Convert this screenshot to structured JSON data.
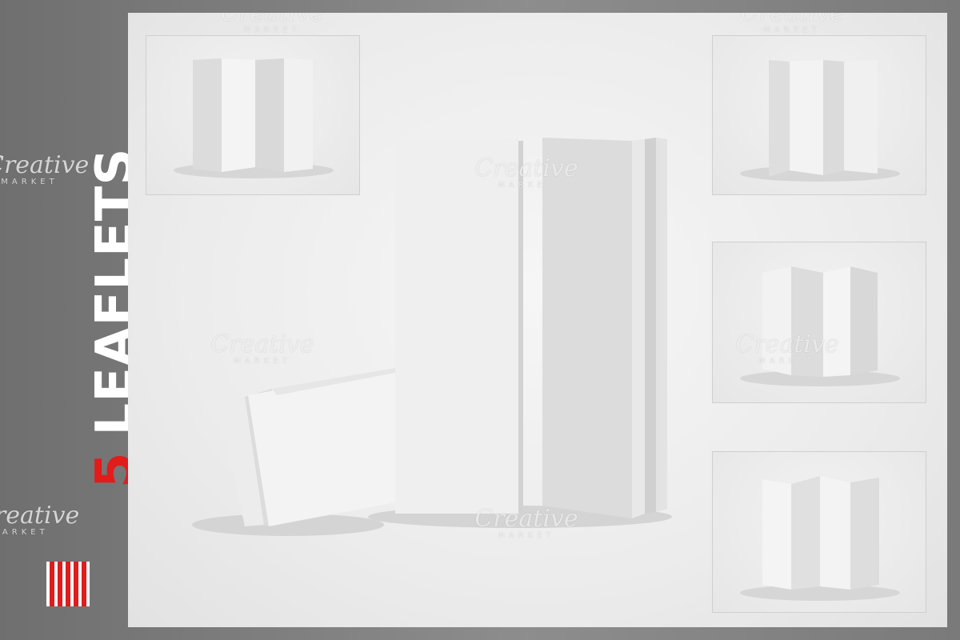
{
  "side": {
    "count": "5",
    "word": "LEAFLETS",
    "accent": "#e21b1b",
    "text_color": "#ffffff"
  },
  "watermark": {
    "main": "Creative",
    "sub": "MARKET"
  },
  "thumbnails": [
    {
      "name": "thumb-top-left",
      "subject": "z-fold leaflet standing, front view"
    },
    {
      "name": "thumb-top-right",
      "subject": "z-fold leaflet standing, angled view"
    },
    {
      "name": "thumb-middle-right",
      "subject": "z-fold leaflet standing, zigzag view"
    },
    {
      "name": "thumb-bottom-right",
      "subject": "z-fold leaflet opened, front view"
    }
  ],
  "main_scene": {
    "subject": "folded leaflet mockups: one lying zigzag, one standing closed, one standing partly open"
  }
}
